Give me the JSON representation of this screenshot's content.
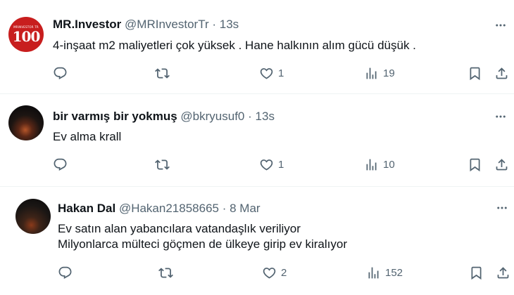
{
  "tweets": [
    {
      "avatar_text_small": "MRINVESTOR TR",
      "avatar_text_big": "100",
      "name": "MR.Investor",
      "handle": "@MRInvestorTr",
      "dot": "·",
      "time": "13s",
      "lines": [
        "4-inşaat m2 maliyetleri çok yüksek . Hane halkının alım gücü düşük ."
      ],
      "likes": "1",
      "views": "19"
    },
    {
      "name": "bir varmış bir yokmuş",
      "handle": "@bkryusuf0",
      "dot": "·",
      "time": "13s",
      "lines": [
        "Ev alma krall"
      ],
      "likes": "1",
      "views": "10"
    },
    {
      "name": "Hakan Dal",
      "handle": "@Hakan21858665",
      "dot": "·",
      "time": "8 Mar",
      "lines": [
        "Ev satın alan yabancılara  vatandaşlık veriliyor",
        "Milyonlarca mülteci göçmen de ülkeye girip ev kiralıyor"
      ],
      "likes": "2",
      "views": "152"
    }
  ],
  "icons": {
    "reply": "reply-icon",
    "retweet": "retweet-icon",
    "like": "heart-icon",
    "views": "views-icon",
    "bookmark": "bookmark-icon",
    "share": "share-icon",
    "more": "more-icon"
  },
  "colors": {
    "text": "#0f1419",
    "secondary": "#536471",
    "accent": "#c81e1e"
  }
}
